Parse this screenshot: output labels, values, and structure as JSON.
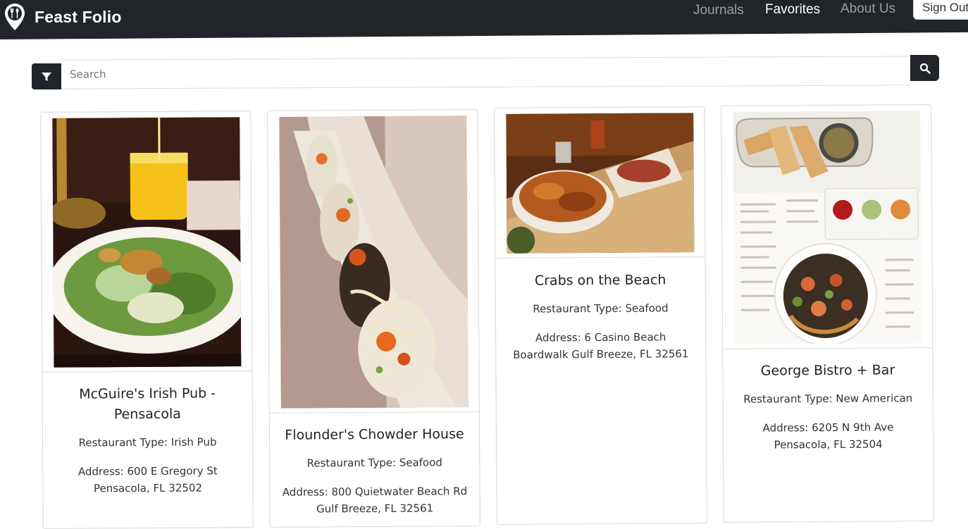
{
  "navbar": {
    "brand": "Feast Folio",
    "links": [
      {
        "label": "Journals",
        "active": false
      },
      {
        "label": "Favorites",
        "active": true
      },
      {
        "label": "About Us",
        "active": false
      }
    ],
    "sign_out": "Sign Out"
  },
  "search": {
    "placeholder": "Search",
    "value": ""
  },
  "cards": [
    {
      "name": "McGuire's Irish Pub - Pensacola",
      "type": "Restaurant Type: Irish Pub",
      "address": "Address: 600 E Gregory St Pensacola, FL 32502"
    },
    {
      "name": "Flounder's Chowder House",
      "type": "Restaurant Type: Seafood",
      "address": "Address: 800 Quietwater Beach Rd Gulf Breeze, FL 32561"
    },
    {
      "name": "Crabs on the Beach",
      "type": "Restaurant Type: Seafood",
      "address": "Address: 6 Casino Beach Boardwalk Gulf Breeze, FL 32561"
    },
    {
      "name": "George Bistro + Bar",
      "type": "Restaurant Type: New American",
      "address": "Address: 6205 N 9th Ave Pensacola, FL 32504"
    }
  ],
  "colors": {
    "navbar_bg": "#212529",
    "nav_link": "#9a9da1",
    "nav_link_active": "#ffffff"
  },
  "icons": {
    "brand": "map-pin-fork-spoon-icon",
    "filter": "funnel-icon",
    "search": "magnifier-icon"
  }
}
